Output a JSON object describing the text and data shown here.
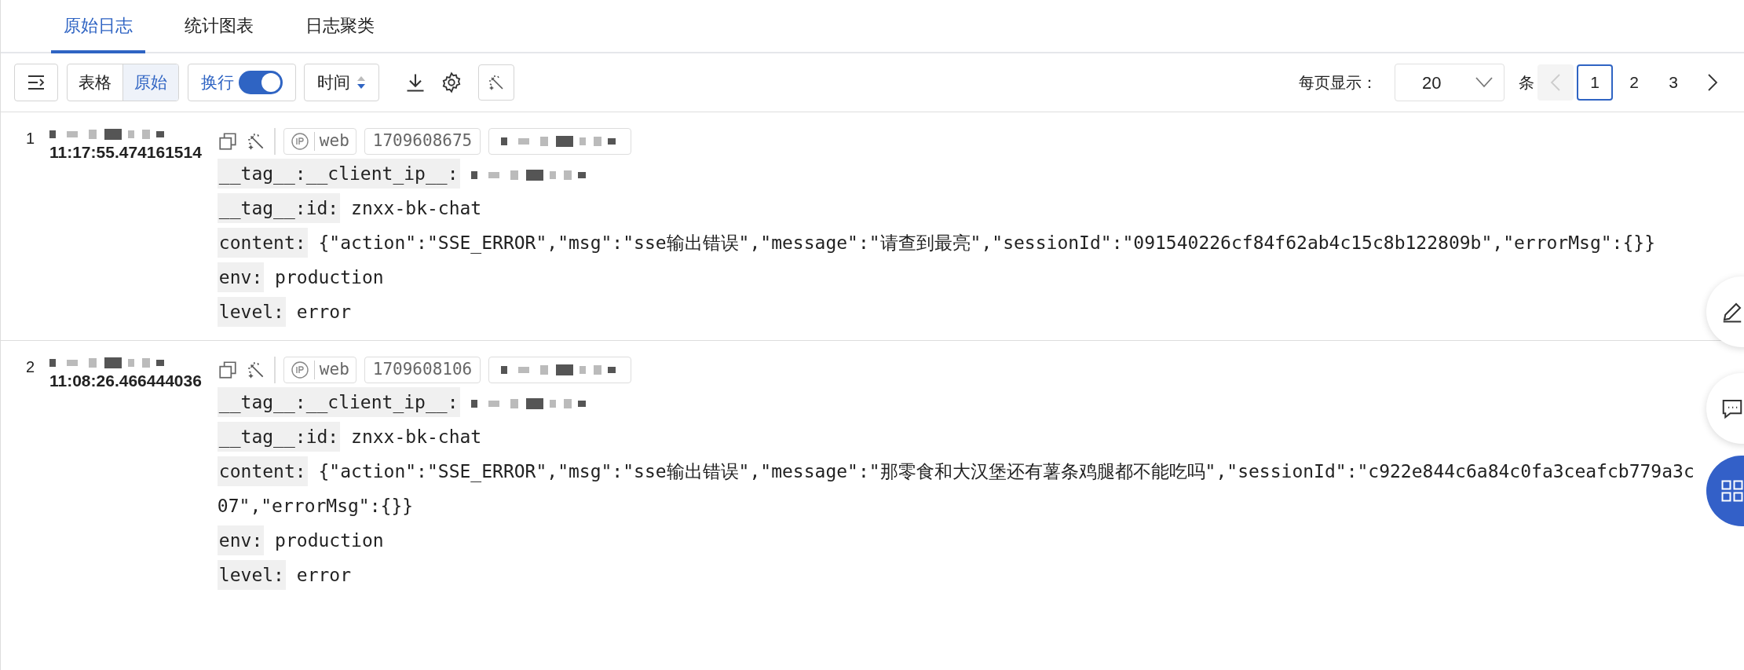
{
  "tabs": [
    {
      "label": "原始日志",
      "selected": true
    },
    {
      "label": "统计图表",
      "selected": false
    },
    {
      "label": "日志聚类",
      "selected": false
    }
  ],
  "toolbar": {
    "view_modes": [
      {
        "label": "表格",
        "selected": false
      },
      {
        "label": "原始",
        "selected": true
      }
    ],
    "wrap": {
      "label": "换行",
      "on": true
    },
    "sort": {
      "label": "时间",
      "descending": true
    }
  },
  "pagination": {
    "page_size_label": "每页显示：",
    "page_size": "20",
    "unit": "条",
    "prev_disabled": true,
    "pages": [
      {
        "label": "1",
        "selected": true
      },
      {
        "label": "2",
        "selected": false
      },
      {
        "label": "3",
        "selected": false
      }
    ]
  },
  "logs": [
    {
      "index": "1",
      "time": "11:17:55.474161514",
      "tags": [
        {
          "kind": "source",
          "label": "web"
        },
        {
          "kind": "text",
          "label": "1709608675"
        },
        {
          "kind": "redacted"
        }
      ],
      "fields": [
        {
          "key": "__tag__:__client_ip__:",
          "kind": "redacted"
        },
        {
          "key": "__tag__:id:",
          "kind": "text",
          "value": "znxx-bk-chat"
        },
        {
          "key": "content:",
          "kind": "text",
          "value": "{\"action\":\"SSE_ERROR\",\"msg\":\"sse输出错误\",\"message\":\"请查到最亮\",\"sessionId\":\"091540226cf84f62ab4c15c8b122809b\",\"errorMsg\":{}}"
        },
        {
          "key": "env:",
          "kind": "text",
          "value": "production"
        },
        {
          "key": "level:",
          "kind": "text",
          "value": "error"
        }
      ]
    },
    {
      "index": "2",
      "time": "11:08:26.466444036",
      "tags": [
        {
          "kind": "source",
          "label": "web"
        },
        {
          "kind": "text",
          "label": "1709608106"
        },
        {
          "kind": "redacted"
        }
      ],
      "fields": [
        {
          "key": "__tag__:__client_ip__:",
          "kind": "redacted"
        },
        {
          "key": "__tag__:id:",
          "kind": "text",
          "value": "znxx-bk-chat"
        },
        {
          "key": "content:",
          "kind": "text",
          "value": "{\"action\":\"SSE_ERROR\",\"msg\":\"sse输出错误\",\"message\":\"那零食和大汉堡还有薯条鸡腿都不能吃吗\",\"sessionId\":\"c922e844c6a84c0fa3ceafcb779a3c07\",\"errorMsg\":{}}"
        },
        {
          "key": "env:",
          "kind": "text",
          "value": "production"
        },
        {
          "key": "level:",
          "kind": "text",
          "value": "error"
        }
      ]
    }
  ]
}
